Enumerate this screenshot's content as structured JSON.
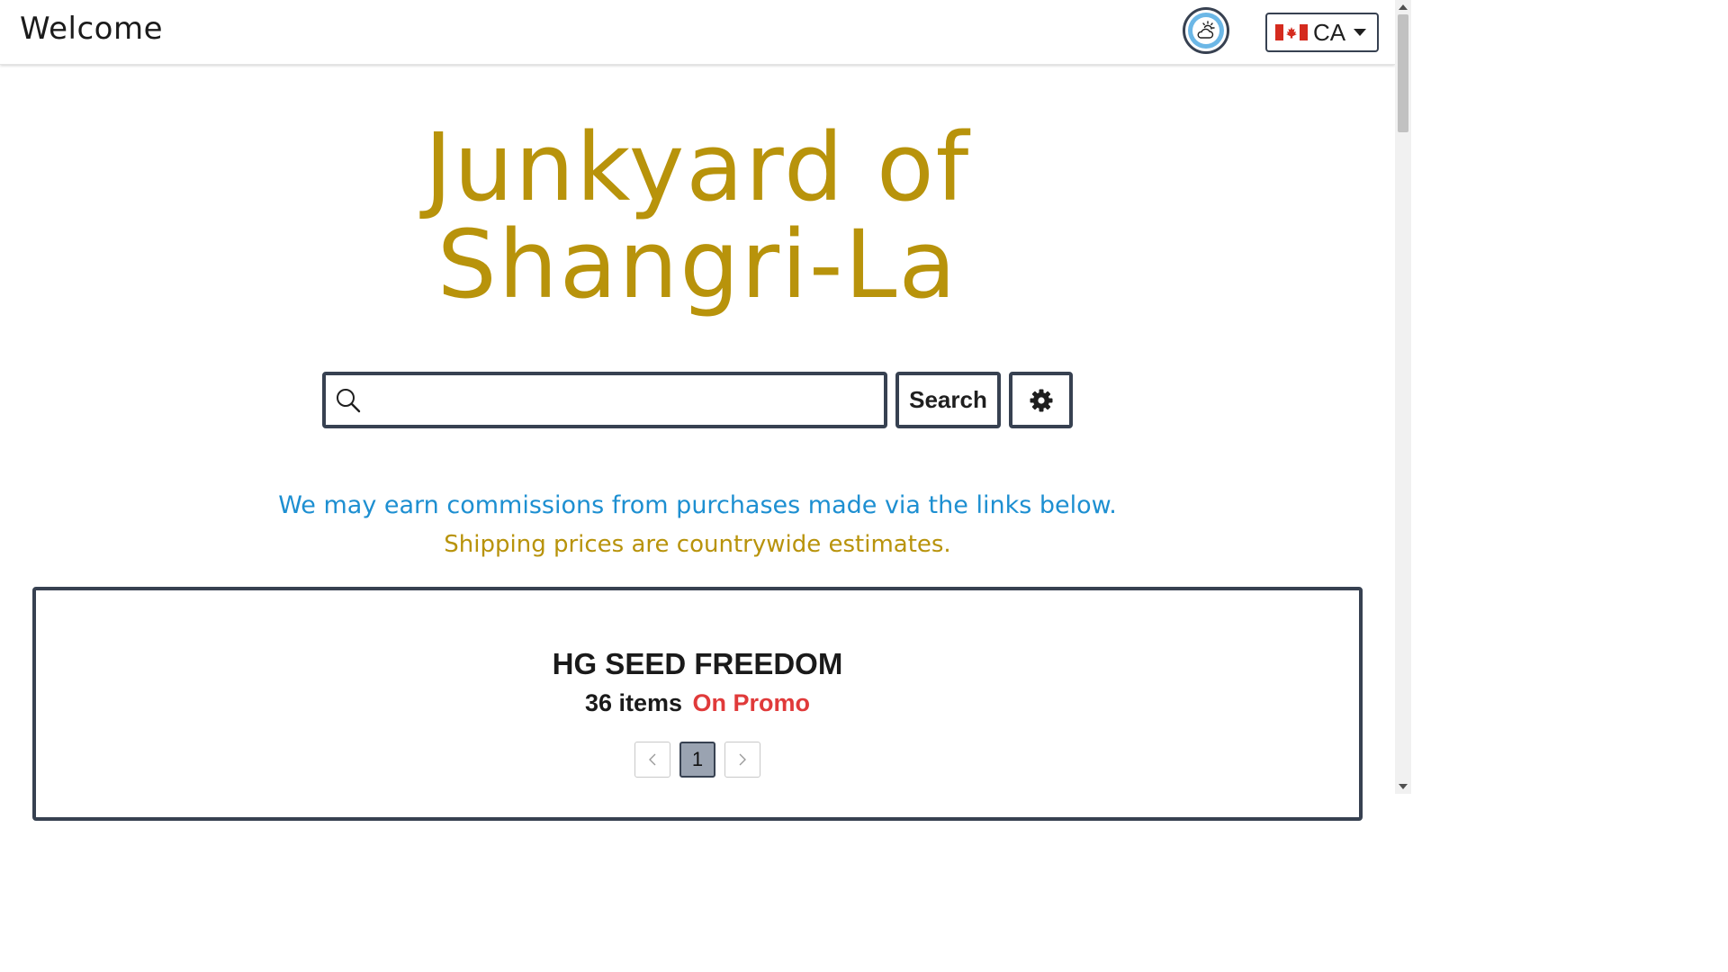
{
  "header": {
    "welcome": "Welcome",
    "weather_icon": "partly-cloudy-icon",
    "country": {
      "flag": "canada-flag-icon",
      "code": "CA"
    }
  },
  "hero": {
    "title_line1": "Junkyard of",
    "title_line2": "Shangri-La",
    "title_color": "#b8930b"
  },
  "search": {
    "placeholder": "",
    "value": "",
    "button_label": "Search",
    "settings_icon": "gear-icon"
  },
  "notices": {
    "commission": "We may earn commissions from purchases made via the links below.",
    "commission_color": "#1d8fd1",
    "shipping": "Shipping prices are countrywide estimates.",
    "shipping_color": "#b8930b"
  },
  "product": {
    "title": "HG SEED FREEDOM",
    "count_text": "36 items",
    "promo_text": "On Promo",
    "promo_color": "#e03a3a",
    "pagination": {
      "current_page": "1"
    }
  }
}
